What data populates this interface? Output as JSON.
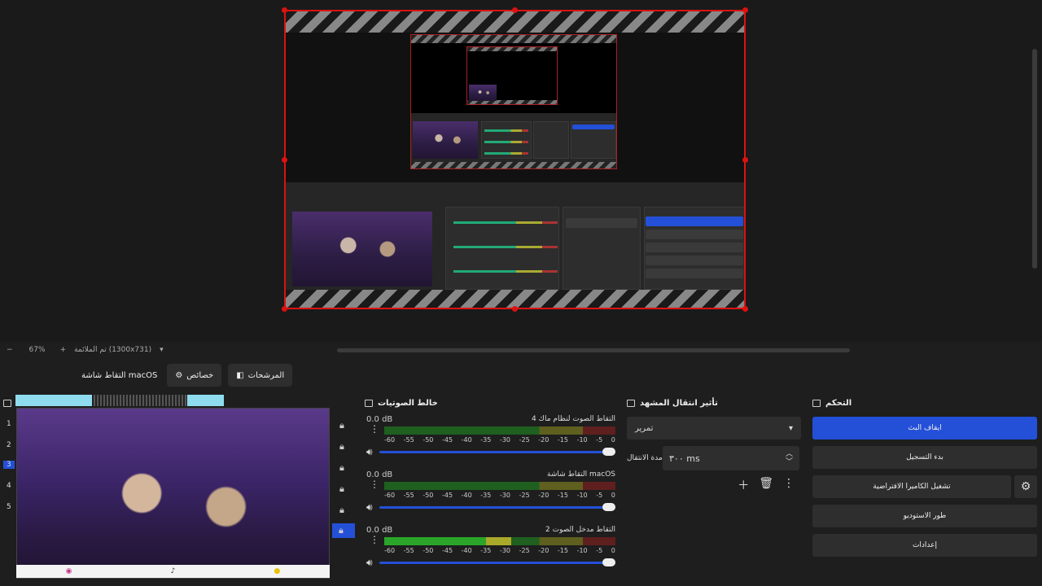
{
  "preview": {
    "zoom_label": "67%",
    "zoom_minus": "−",
    "zoom_plus": "+",
    "fit_label": "تم الملائمة (1300x731)"
  },
  "source_bar": {
    "source_name": "التقاط شاشة macOS",
    "properties_label": "خصائص",
    "filters_label": "المرشحات"
  },
  "scenes": {
    "numbers": [
      "1",
      "2",
      "3",
      "4",
      "5"
    ],
    "active_index": 2,
    "footer_items": [
      "instagram",
      "tiktok",
      "snapchat"
    ]
  },
  "mixer": {
    "title": "خالط الصوتيات",
    "channels": [
      {
        "name": "التقاط الصوت لنظام ماك 4",
        "db": "0.0 dB",
        "level": 0.0
      },
      {
        "name": "التقاط شاشة macOS",
        "db": "0.0 dB",
        "level": 0.0
      },
      {
        "name": "التقاط مدخل الصوت 2",
        "db": "0.0 dB",
        "level": 0.55
      }
    ],
    "ticks": [
      "-60",
      "-55",
      "-50",
      "-45",
      "-40",
      "-35",
      "-30",
      "-25",
      "-20",
      "-15",
      "-10",
      "-5",
      "0"
    ]
  },
  "transitions": {
    "title": "تأثير انتقال المشهد",
    "selected": "تمرير",
    "duration_label": "مدة الانتقال",
    "duration_value": "٣٠٠ ms"
  },
  "controls": {
    "title": "التحكم",
    "stop_stream": "ايقاف البث",
    "start_recording": "بدء التسجيل",
    "virtual_camera": "تشغيل الكاميرا الافتراضية",
    "studio_mode": "طور الاستوديو",
    "settings": "إعدادات"
  },
  "colors": {
    "accent": "#2450d8",
    "selection_red": "#d11111"
  }
}
